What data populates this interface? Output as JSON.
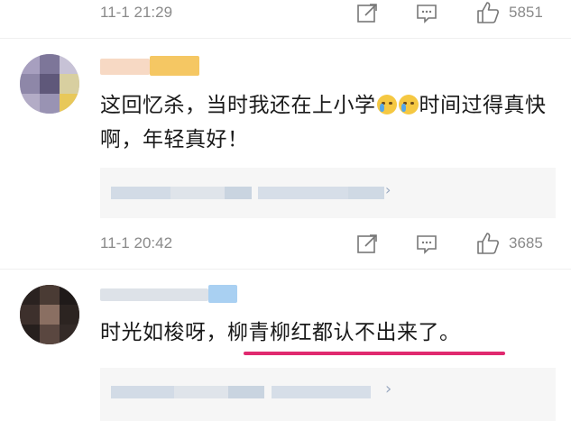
{
  "comments": [
    {
      "time": "11-1 21:29",
      "likes": "5851"
    },
    {
      "time": "11-1 20:42",
      "likes": "3685",
      "text_part1": "这回忆杀，当时我还在上小学",
      "text_part2": "时间过得真快啊，年轻真好！",
      "emoji": "crying-face-icon"
    },
    {
      "text_part1": "时光如梭呀，",
      "text_highlight": "柳青柳红都认不出来了。"
    }
  ],
  "colors": {
    "meta_text": "#8a8a8a",
    "highlight_underline": "#e0296f",
    "reply_bg": "#f6f6f6"
  },
  "icons": [
    "share-icon",
    "comment-icon",
    "like-icon",
    "chevron-right-icon"
  ]
}
